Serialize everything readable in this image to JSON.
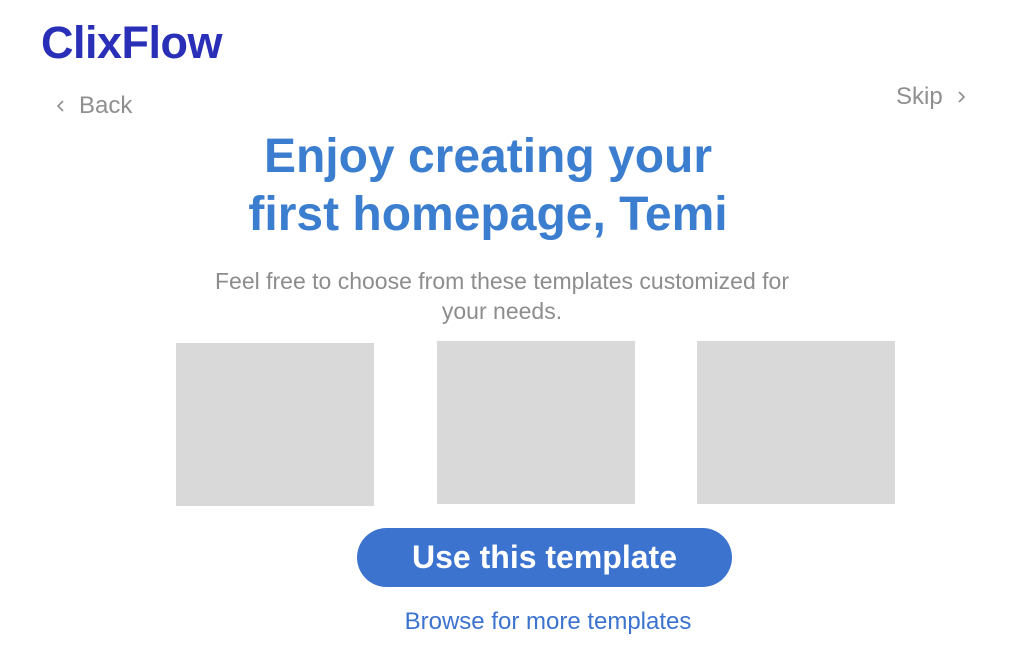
{
  "brand": {
    "name": "ClixFlow"
  },
  "nav": {
    "back_label": "Back",
    "back_icon": "chevron-left-icon",
    "skip_label": "Skip",
    "skip_icon": "chevron-right-icon"
  },
  "hero": {
    "headline_line1": "Enjoy creating your",
    "headline_line2": "first homepage, Temi",
    "subtitle": "Feel free to choose from these templates customized for your needs."
  },
  "templates": [
    {
      "id": "template-1"
    },
    {
      "id": "template-2"
    },
    {
      "id": "template-3"
    }
  ],
  "actions": {
    "primary_label": "Use this template",
    "secondary_label": "Browse for more templates"
  },
  "colors": {
    "brand": "#2a2fb8",
    "heading": "#3b7dcf",
    "primary": "#3b73cf",
    "muted_text": "#8d8d8d",
    "placeholder": "#d9d9d9"
  }
}
